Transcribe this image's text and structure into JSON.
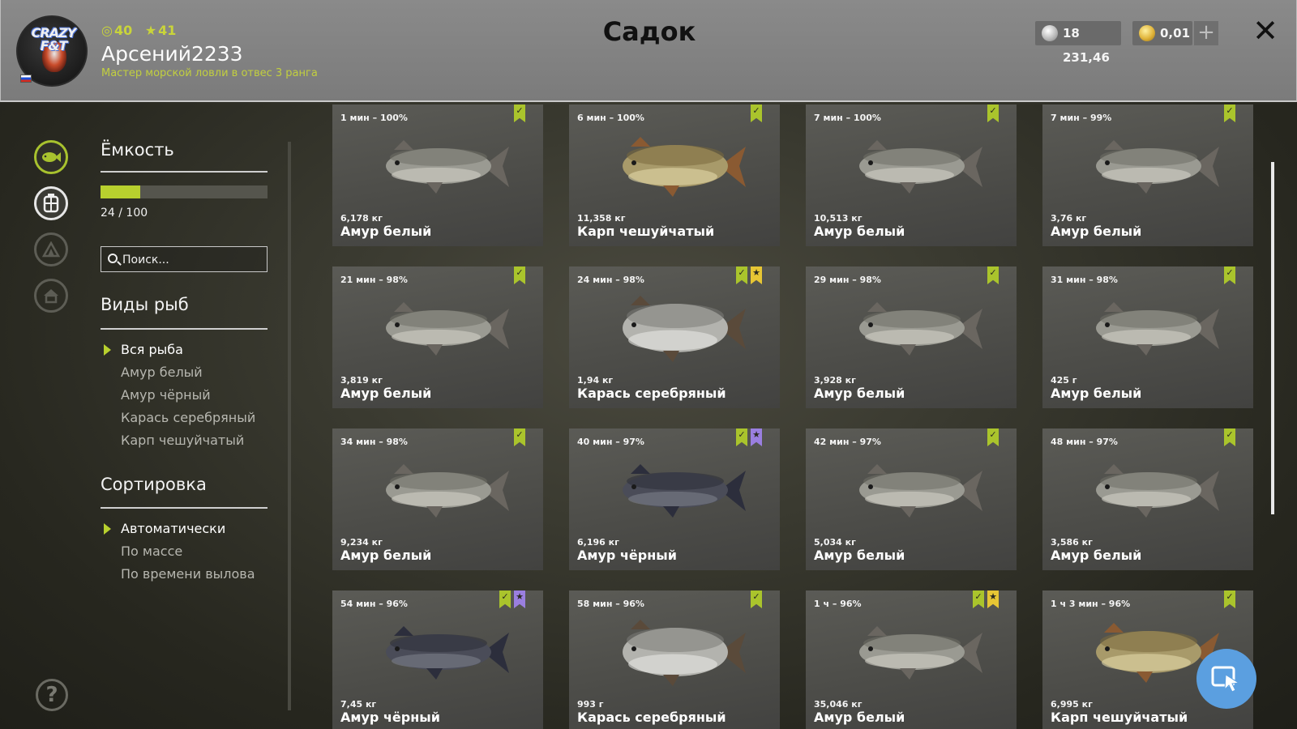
{
  "header": {
    "title": "Садок",
    "level": "40",
    "stars": "41",
    "username": "Арсений2233",
    "rank": "Мастер морской ловли в отвес 3 ранга",
    "silver": "18 231,46",
    "gold": "0,01",
    "add_label": "+",
    "close_label": "✕",
    "logo_text": "CRAZY F&T"
  },
  "capacity": {
    "title": "Ёмкость",
    "label": "24 / 100",
    "used": 24,
    "max": 100
  },
  "search": {
    "placeholder": "Поиск..."
  },
  "species": {
    "title": "Виды рыб",
    "items": [
      "Вся рыба",
      "Амур белый",
      "Амур чёрный",
      "Карась серебряный",
      "Карп чешуйчатый"
    ],
    "selected": "Вся рыба"
  },
  "sorting": {
    "title": "Сортировка",
    "items": [
      "Автоматически",
      "По массе",
      "По времени вылова"
    ],
    "selected": "Автоматически"
  },
  "help_label": "?",
  "colors": {
    "accent_green": "#b8d02e",
    "tag_green": "#aac42c",
    "tag_yellow": "#e7c634",
    "tag_purple": "#9a7fe0",
    "fab_blue": "#5b9fe0"
  },
  "fish_cards": [
    {
      "time": "1 мин – 100%",
      "weight": "6,178 кг",
      "name": "Амур белый",
      "species": "grass-carp",
      "tags": [
        "green"
      ]
    },
    {
      "time": "6 мин – 100%",
      "weight": "11,358 кг",
      "name": "Карп чешуйчатый",
      "species": "carp",
      "tags": [
        "green"
      ]
    },
    {
      "time": "7 мин – 100%",
      "weight": "10,513 кг",
      "name": "Амур белый",
      "species": "grass-carp",
      "tags": [
        "green"
      ]
    },
    {
      "time": "7 мин – 99%",
      "weight": "3,76 кг",
      "name": "Амур белый",
      "species": "grass-carp",
      "tags": [
        "green"
      ]
    },
    {
      "time": "21 мин – 98%",
      "weight": "3,819 кг",
      "name": "Амур белый",
      "species": "grass-carp",
      "tags": [
        "green"
      ]
    },
    {
      "time": "24 мин – 98%",
      "weight": "1,94 кг",
      "name": "Карась серебряный",
      "species": "crucian",
      "tags": [
        "green",
        "yellow"
      ]
    },
    {
      "time": "29 мин – 98%",
      "weight": "3,928 кг",
      "name": "Амур белый",
      "species": "grass-carp",
      "tags": [
        "green"
      ]
    },
    {
      "time": "31 мин – 98%",
      "weight": "425 г",
      "name": "Амур белый",
      "species": "grass-carp",
      "tags": [
        "green"
      ]
    },
    {
      "time": "34 мин – 98%",
      "weight": "9,234 кг",
      "name": "Амур белый",
      "species": "grass-carp",
      "tags": [
        "green"
      ]
    },
    {
      "time": "40 мин – 97%",
      "weight": "6,196 кг",
      "name": "Амур чёрный",
      "species": "black-carp",
      "tags": [
        "green",
        "purple"
      ]
    },
    {
      "time": "42 мин – 97%",
      "weight": "5,034 кг",
      "name": "Амур белый",
      "species": "grass-carp",
      "tags": [
        "green"
      ]
    },
    {
      "time": "48 мин – 97%",
      "weight": "3,586 кг",
      "name": "Амур белый",
      "species": "grass-carp",
      "tags": [
        "green"
      ]
    },
    {
      "time": "54 мин – 96%",
      "weight": "7,45 кг",
      "name": "Амур чёрный",
      "species": "black-carp",
      "tags": [
        "green",
        "purple"
      ]
    },
    {
      "time": "58 мин – 96%",
      "weight": "993 г",
      "name": "Карась серебряный",
      "species": "crucian",
      "tags": [
        "green"
      ]
    },
    {
      "time": "1 ч – 96%",
      "weight": "35,046 кг",
      "name": "Амур белый",
      "species": "grass-carp",
      "tags": [
        "green",
        "yellow"
      ]
    },
    {
      "time": "1 ч 3 мин – 96%",
      "weight": "6,995 кг",
      "name": "Карп чешуйчатый",
      "species": "carp",
      "tags": [
        "green"
      ]
    }
  ]
}
